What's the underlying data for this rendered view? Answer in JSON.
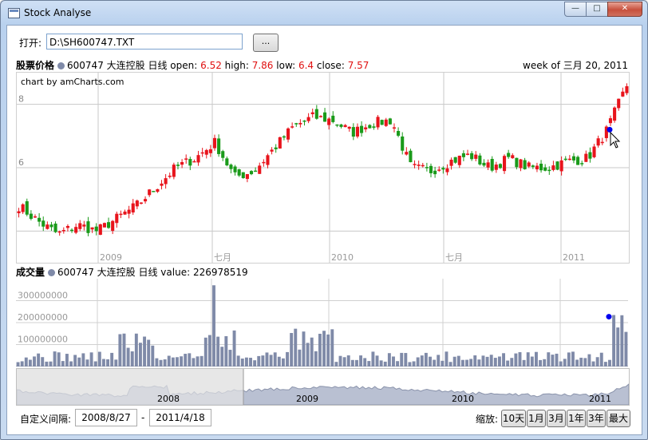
{
  "window": {
    "title": "Stock Analyse",
    "minimize": "—",
    "maximize": "□",
    "close": "✕"
  },
  "file": {
    "label": "打开:",
    "path": "D:\\SH600747.TXT",
    "browse_label": "..."
  },
  "price_header": {
    "title": "股票价格",
    "series": "600747 大连控股 日线",
    "open_label": "open:",
    "open": "6.52",
    "high_label": "high:",
    "high": "7.86",
    "low_label": "low:",
    "low": "6.4",
    "close_label": "close:",
    "close": "7.57",
    "date_info": "week of 三月 20, 2011"
  },
  "credit": "chart by amCharts.com",
  "volume_header": {
    "title": "成交量",
    "series": "600747 大连控股 日线",
    "value_label": "value:",
    "value": "226978519"
  },
  "bottom": {
    "range_label": "自定义间隔:",
    "from": "2008/8/27",
    "sep": "-",
    "to": "2011/4/18",
    "zoom_label": "缩放:",
    "zoom_buttons": [
      "10天",
      "1月",
      "3月",
      "1年",
      "3年",
      "最大"
    ]
  },
  "colors": {
    "up": "#e8141c",
    "down": "#1a9a1a",
    "volume": "#7f8aa8",
    "cursor": "#0000ee"
  },
  "chart_data": [
    {
      "type": "candlestick",
      "title": "股票价格",
      "series_name": "600747 大连控股 日线",
      "x_ticks": [
        "2009",
        "七月",
        "2010",
        "七月",
        "2011"
      ],
      "y_ticks": [
        6,
        8
      ],
      "ylim": [
        3.0,
        9.0
      ],
      "grid": true,
      "close_path": [
        [
          "2008-09",
          4.8
        ],
        [
          "2008-10",
          4.3
        ],
        [
          "2008-11",
          3.9
        ],
        [
          "2008-12",
          4.2
        ],
        [
          "2009-01",
          4.0
        ],
        [
          "2009-02",
          4.4
        ],
        [
          "2009-03",
          4.8
        ],
        [
          "2009-04",
          5.4
        ],
        [
          "2009-05",
          6.0
        ],
        [
          "2009-06",
          6.3
        ],
        [
          "2009-07",
          6.8
        ],
        [
          "2009-08",
          5.7
        ],
        [
          "2009-09",
          5.9
        ],
        [
          "2009-10",
          6.6
        ],
        [
          "2009-11",
          7.3
        ],
        [
          "2009-12",
          7.6
        ],
        [
          "2010-01",
          7.5
        ],
        [
          "2010-02",
          7.1
        ],
        [
          "2010-03",
          7.4
        ],
        [
          "2010-04",
          7.5
        ],
        [
          "2010-05",
          6.0
        ],
        [
          "2010-06",
          5.9
        ],
        [
          "2010-07",
          6.2
        ],
        [
          "2010-08",
          6.4
        ],
        [
          "2010-09",
          6.0
        ],
        [
          "2010-10",
          6.3
        ],
        [
          "2010-11",
          6.0
        ],
        [
          "2010-12",
          6.0
        ],
        [
          "2011-01",
          6.2
        ],
        [
          "2011-02",
          6.3
        ],
        [
          "2011-03",
          7.2
        ],
        [
          "2011-04",
          8.6
        ]
      ]
    },
    {
      "type": "bar",
      "title": "成交量",
      "series_name": "600747 大连控股 日线",
      "y_ticks": [
        100000000,
        200000000,
        300000000
      ],
      "ylim": [
        0,
        400000000
      ],
      "grid": true
    },
    {
      "type": "area",
      "title": "scrollbar",
      "x_ticks": [
        "2008",
        "2009",
        "2010",
        "2011"
      ]
    }
  ]
}
